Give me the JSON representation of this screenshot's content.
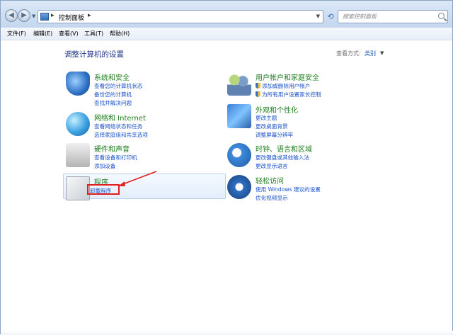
{
  "address": {
    "location": "控制面板",
    "separator": "▸"
  },
  "search": {
    "placeholder": "搜索控制面板"
  },
  "menu": [
    {
      "label": "文件(F)"
    },
    {
      "label": "编辑(E)"
    },
    {
      "label": "查看(V)"
    },
    {
      "label": "工具(T)"
    },
    {
      "label": "帮助(H)"
    }
  ],
  "content": {
    "title": "调整计算机的设置",
    "view_by_label": "查看方式:",
    "view_by_value": "类别"
  },
  "categories": {
    "system": {
      "title": "系统和安全",
      "links": [
        "查看您的计算机状态",
        "备份您的计算机",
        "查找并解决问题"
      ]
    },
    "network": {
      "title": "网络和 Internet",
      "links": [
        "查看网络状态和任务",
        "选择家庭组和共享选项"
      ]
    },
    "hardware": {
      "title": "硬件和声音",
      "links": [
        "查看设备和打印机",
        "添加设备"
      ]
    },
    "programs": {
      "title": "程序",
      "links": [
        "卸载程序"
      ]
    },
    "users": {
      "title": "用户帐户和家庭安全",
      "links": [
        "添加或删除用户帐户",
        "为所有用户设置家长控制"
      ]
    },
    "appearance": {
      "title": "外观和个性化",
      "links": [
        "更改主题",
        "更改桌面背景",
        "调整屏幕分辨率"
      ]
    },
    "clock": {
      "title": "时钟、语言和区域",
      "links": [
        "更改键盘或其他输入法",
        "更改显示语言"
      ]
    },
    "ease": {
      "title": "轻松访问",
      "links": [
        "使用 Windows 建议的设置",
        "优化视频显示"
      ]
    }
  },
  "colors": {
    "link": "#1a52c9",
    "category_title": "#1e7d1e",
    "annotation": "#e02020"
  }
}
